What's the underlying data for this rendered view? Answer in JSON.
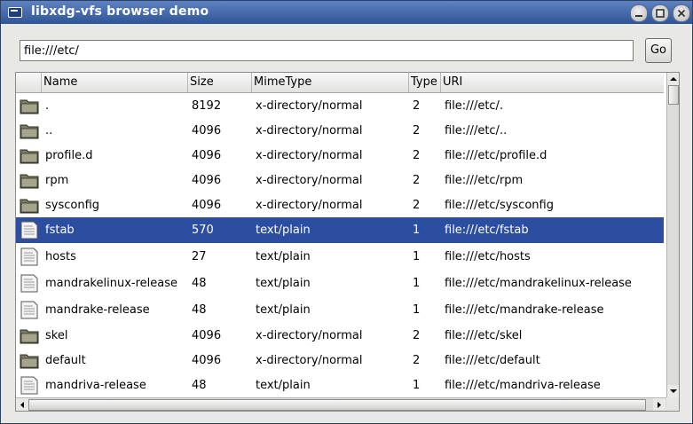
{
  "window": {
    "title": "libxdg-vfs browser demo",
    "icon": "window-icon",
    "controls": [
      "minimize-icon",
      "maximize-icon",
      "close-icon"
    ]
  },
  "toolbar": {
    "url_value": "file:///etc/",
    "go_label": "Go"
  },
  "list": {
    "columns": [
      "Name",
      "Size",
      "MimeType",
      "Type",
      "URI"
    ],
    "selected_index": 5,
    "rows": [
      {
        "icon": "folder-icon",
        "name": ".",
        "size": "8192",
        "mime": "x-directory/normal",
        "type": "2",
        "uri": "file:///etc/."
      },
      {
        "icon": "folder-icon",
        "name": "..",
        "size": "4096",
        "mime": "x-directory/normal",
        "type": "2",
        "uri": "file:///etc/.."
      },
      {
        "icon": "folder-icon",
        "name": "profile.d",
        "size": "4096",
        "mime": "x-directory/normal",
        "type": "2",
        "uri": "file:///etc/profile.d"
      },
      {
        "icon": "folder-icon",
        "name": "rpm",
        "size": "4096",
        "mime": "x-directory/normal",
        "type": "2",
        "uri": "file:///etc/rpm"
      },
      {
        "icon": "folder-icon",
        "name": "sysconfig",
        "size": "4096",
        "mime": "x-directory/normal",
        "type": "2",
        "uri": "file:///etc/sysconfig"
      },
      {
        "icon": "text-file-icon",
        "name": "fstab",
        "size": "570",
        "mime": "text/plain",
        "type": "1",
        "uri": "file:///etc/fstab"
      },
      {
        "icon": "text-file-icon",
        "name": "hosts",
        "size": "27",
        "mime": "text/plain",
        "type": "1",
        "uri": "file:///etc/hosts"
      },
      {
        "icon": "text-file-icon",
        "name": "mandrakelinux-release",
        "size": "48",
        "mime": "text/plain",
        "type": "1",
        "uri": "file:///etc/mandrakelinux-release"
      },
      {
        "icon": "text-file-icon",
        "name": "mandrake-release",
        "size": "48",
        "mime": "text/plain",
        "type": "1",
        "uri": "file:///etc/mandrake-release"
      },
      {
        "icon": "folder-icon",
        "name": "skel",
        "size": "4096",
        "mime": "x-directory/normal",
        "type": "2",
        "uri": "file:///etc/skel"
      },
      {
        "icon": "folder-icon",
        "name": "default",
        "size": "4096",
        "mime": "x-directory/normal",
        "type": "2",
        "uri": "file:///etc/default"
      },
      {
        "icon": "text-file-icon",
        "name": "mandriva-release",
        "size": "48",
        "mime": "text/plain",
        "type": "1",
        "uri": "file:///etc/mandriva-release"
      }
    ]
  },
  "colors": {
    "titlebar": "#3b64ab",
    "selection": "#2c4ea1"
  }
}
